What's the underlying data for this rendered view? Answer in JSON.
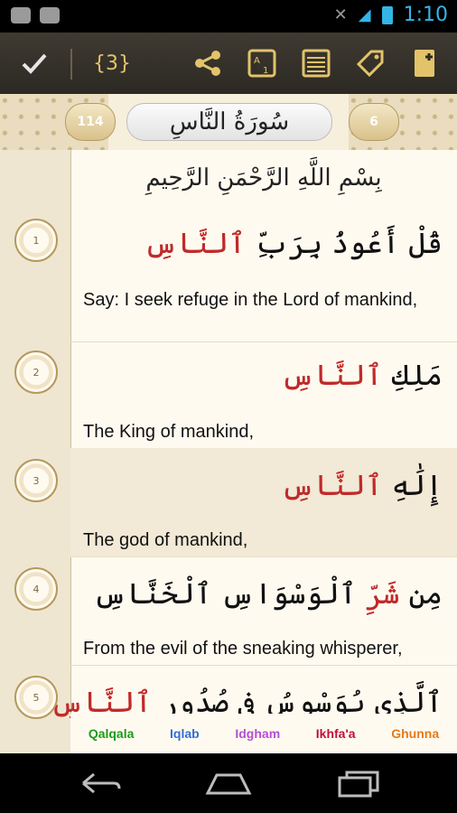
{
  "status_bar": {
    "time": "1:10"
  },
  "toolbar": {
    "page_counter": "{3}",
    "actions": [
      "check-icon",
      "share-icon",
      "translate-icon",
      "calendar-grid-icon",
      "tag-icon",
      "bookmark-add-icon"
    ]
  },
  "header": {
    "surah_number": "114",
    "ayah_count": "6",
    "surah_name": "سُورَةُ النَّاسِ"
  },
  "basmala": "بِسْمِ اللَّهِ الرَّحْمَنِ الرَّحِيمِ",
  "ayahs": [
    {
      "number": "1",
      "arabic": "قُلْ أَعُوذُ بِرَبِّ",
      "arabic_highlight": " ٱلنَّاسِ",
      "translation": "Say: I seek refuge in the Lord of mankind,"
    },
    {
      "number": "2",
      "arabic": "مَلِكِ",
      "arabic_highlight": " ٱلنَّاسِ",
      "translation": "The King of mankind,"
    },
    {
      "number": "3",
      "arabic": "إِلَٰهِ",
      "arabic_highlight": " ٱلنَّاسِ",
      "translation": "The god of mankind,"
    },
    {
      "number": "4",
      "arabic": "مِن ",
      "arabic_highlight": "شَرِّ",
      "arabic_rest": " ٱلْوَسْوَاسِ ٱلْخَنَّاسِ",
      "translation": "From the evil of the sneaking whisperer,"
    },
    {
      "number": "5",
      "arabic": "ٱلَّذِى يُوَسْوِسُ فِى صُدُورِ",
      "arabic_highlight": " ٱلنَّاسِ",
      "translation": ""
    }
  ],
  "legend": [
    {
      "label": "Qalqala",
      "color": "#1a9b1a"
    },
    {
      "label": "Iqlab",
      "color": "#2f6fd6"
    },
    {
      "label": "Idgham",
      "color": "#b44fd6"
    },
    {
      "label": "Ikhfa'a",
      "color": "#c0103a"
    },
    {
      "label": "Ghunna",
      "color": "#e57a17"
    }
  ]
}
